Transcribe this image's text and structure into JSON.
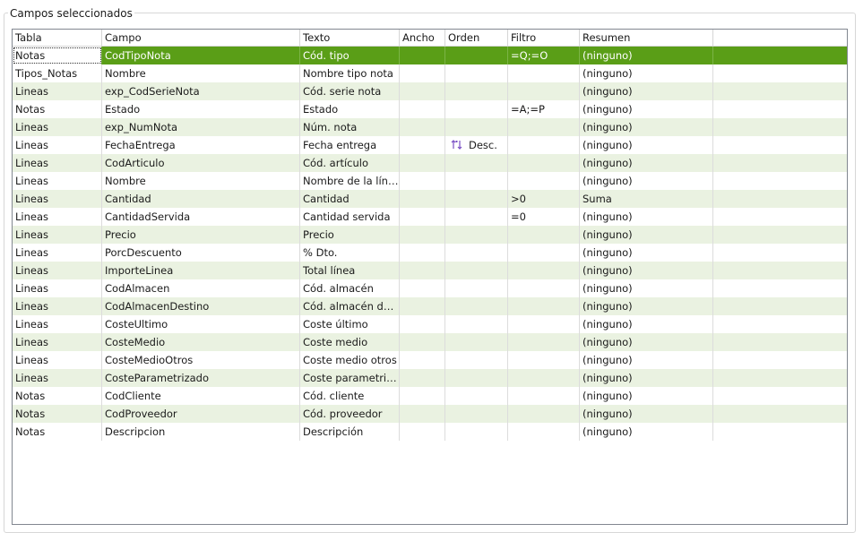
{
  "group_title": "Campos seleccionados",
  "colors": {
    "selected_row": "#5a9e17",
    "alt_row": "#eaf2e1",
    "sort_icon": "#7a4fc4"
  },
  "columns": [
    "Tabla",
    "Campo",
    "Texto",
    "Ancho",
    "Orden",
    "Filtro",
    "Resumen"
  ],
  "rows": [
    {
      "tabla": "Notas",
      "campo": "CodTipoNota",
      "texto": "Cód. tipo",
      "ancho": "",
      "orden": "",
      "filtro": "=Q;=O",
      "resumen": "(ninguno)"
    },
    {
      "tabla": "Tipos_Notas",
      "campo": "Nombre",
      "texto": "Nombre tipo nota",
      "ancho": "",
      "orden": "",
      "filtro": "",
      "resumen": "(ninguno)"
    },
    {
      "tabla": "Lineas",
      "campo": "exp_CodSerieNota",
      "texto": "Cód. serie nota",
      "ancho": "",
      "orden": "",
      "filtro": "",
      "resumen": "(ninguno)"
    },
    {
      "tabla": "Notas",
      "campo": "Estado",
      "texto": "Estado",
      "ancho": "",
      "orden": "",
      "filtro": "=A;=P",
      "resumen": "(ninguno)"
    },
    {
      "tabla": "Lineas",
      "campo": "exp_NumNota",
      "texto": "Núm. nota",
      "ancho": "",
      "orden": "",
      "filtro": "",
      "resumen": "(ninguno)"
    },
    {
      "tabla": "Lineas",
      "campo": "FechaEntrega",
      "texto": "Fecha entrega",
      "ancho": "",
      "orden": "Desc.",
      "orden_icon": "sort-descending-icon",
      "filtro": "",
      "resumen": "(ninguno)"
    },
    {
      "tabla": "Lineas",
      "campo": "CodArticulo",
      "texto": "Cód. artículo",
      "ancho": "",
      "orden": "",
      "filtro": "",
      "resumen": "(ninguno)"
    },
    {
      "tabla": "Lineas",
      "campo": "Nombre",
      "texto": "Nombre de la línea",
      "ancho": "",
      "orden": "",
      "filtro": "",
      "resumen": "(ninguno)"
    },
    {
      "tabla": "Lineas",
      "campo": "Cantidad",
      "texto": "Cantidad",
      "ancho": "",
      "orden": "",
      "filtro": ">0",
      "resumen": "Suma"
    },
    {
      "tabla": "Lineas",
      "campo": "CantidadServida",
      "texto": "Cantidad servida",
      "ancho": "",
      "orden": "",
      "filtro": "=0",
      "resumen": "(ninguno)"
    },
    {
      "tabla": "Lineas",
      "campo": "Precio",
      "texto": "Precio",
      "ancho": "",
      "orden": "",
      "filtro": "",
      "resumen": "(ninguno)"
    },
    {
      "tabla": "Lineas",
      "campo": "PorcDescuento",
      "texto": "% Dto.",
      "ancho": "",
      "orden": "",
      "filtro": "",
      "resumen": "(ninguno)"
    },
    {
      "tabla": "Lineas",
      "campo": "ImporteLinea",
      "texto": "Total línea",
      "ancho": "",
      "orden": "",
      "filtro": "",
      "resumen": "(ninguno)"
    },
    {
      "tabla": "Lineas",
      "campo": "CodAlmacen",
      "texto": "Cód. almacén",
      "ancho": "",
      "orden": "",
      "filtro": "",
      "resumen": "(ninguno)"
    },
    {
      "tabla": "Lineas",
      "campo": "CodAlmacenDestino",
      "texto": "Cód. almacén des...",
      "ancho": "",
      "orden": "",
      "filtro": "",
      "resumen": "(ninguno)"
    },
    {
      "tabla": "Lineas",
      "campo": "CosteUltimo",
      "texto": "Coste último",
      "ancho": "",
      "orden": "",
      "filtro": "",
      "resumen": "(ninguno)"
    },
    {
      "tabla": "Lineas",
      "campo": "CosteMedio",
      "texto": "Coste medio",
      "ancho": "",
      "orden": "",
      "filtro": "",
      "resumen": "(ninguno)"
    },
    {
      "tabla": "Lineas",
      "campo": "CosteMedioOtros",
      "texto": "Coste medio otros",
      "ancho": "",
      "orden": "",
      "filtro": "",
      "resumen": "(ninguno)"
    },
    {
      "tabla": "Lineas",
      "campo": "CosteParametrizado",
      "texto": "Coste parametriz...",
      "ancho": "",
      "orden": "",
      "filtro": "",
      "resumen": "(ninguno)"
    },
    {
      "tabla": "Notas",
      "campo": "CodCliente",
      "texto": "Cód. cliente",
      "ancho": "",
      "orden": "",
      "filtro": "",
      "resumen": "(ninguno)"
    },
    {
      "tabla": "Notas",
      "campo": "CodProveedor",
      "texto": "Cód. proveedor",
      "ancho": "",
      "orden": "",
      "filtro": "",
      "resumen": "(ninguno)"
    },
    {
      "tabla": "Notas",
      "campo": "Descripcion",
      "texto": "Descripción",
      "ancho": "",
      "orden": "",
      "filtro": "",
      "resumen": "(ninguno)"
    }
  ],
  "selected_row": 0
}
